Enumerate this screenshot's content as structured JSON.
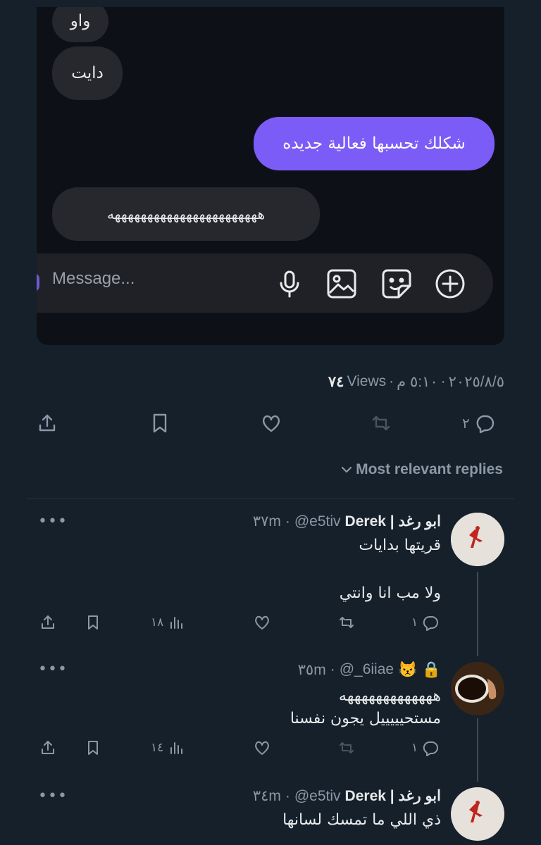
{
  "chat": {
    "messages": [
      {
        "side": "them",
        "text": "واو"
      },
      {
        "side": "them",
        "text": "دايت"
      },
      {
        "side": "me",
        "text": "شكلك تحسبها فعالية جديده"
      },
      {
        "side": "them",
        "text": "هههههههههههههههههههههههه"
      }
    ],
    "input_placeholder": "Message...",
    "icons": [
      "mic-icon",
      "image-icon",
      "sticker-icon",
      "plus-circle-icon"
    ],
    "colors": {
      "bubble_me": "#7b5cf6",
      "bubble_them": "#26282d",
      "background": "#0d1117"
    }
  },
  "tweet": {
    "date": "٢٠٢٥/٨/٥",
    "time": "٥:١٠ م",
    "views_count": "٧٤",
    "views_label": "Views",
    "reply_count": "٢"
  },
  "sort_label": "Most relevant replies",
  "replies": [
    {
      "name": "ابو رغد | Derek",
      "handle": "@e5tiv",
      "time": "٣٧m",
      "lines": [
        "قريتها بدايات",
        "",
        "ولا مب انا وانتي"
      ],
      "reply_count": "١",
      "views": "١٨"
    },
    {
      "name": "😾 🔒",
      "handle": "@_6iiae",
      "time": "٣٥m",
      "lines": [
        "هههههههههههههه",
        "مستحيييييل يجون نفسنا"
      ],
      "reply_count": "١",
      "views": "١٤"
    },
    {
      "name": "ابو رغد | Derek",
      "handle": "@e5tiv",
      "time": "٣٤m",
      "lines": [
        "ذي اللي ما تمسك لسانها"
      ],
      "reply_count": "",
      "views": ""
    }
  ],
  "colors": {
    "background": "#15202b",
    "muted": "#8b98a5",
    "text": "#e7e9ea"
  }
}
